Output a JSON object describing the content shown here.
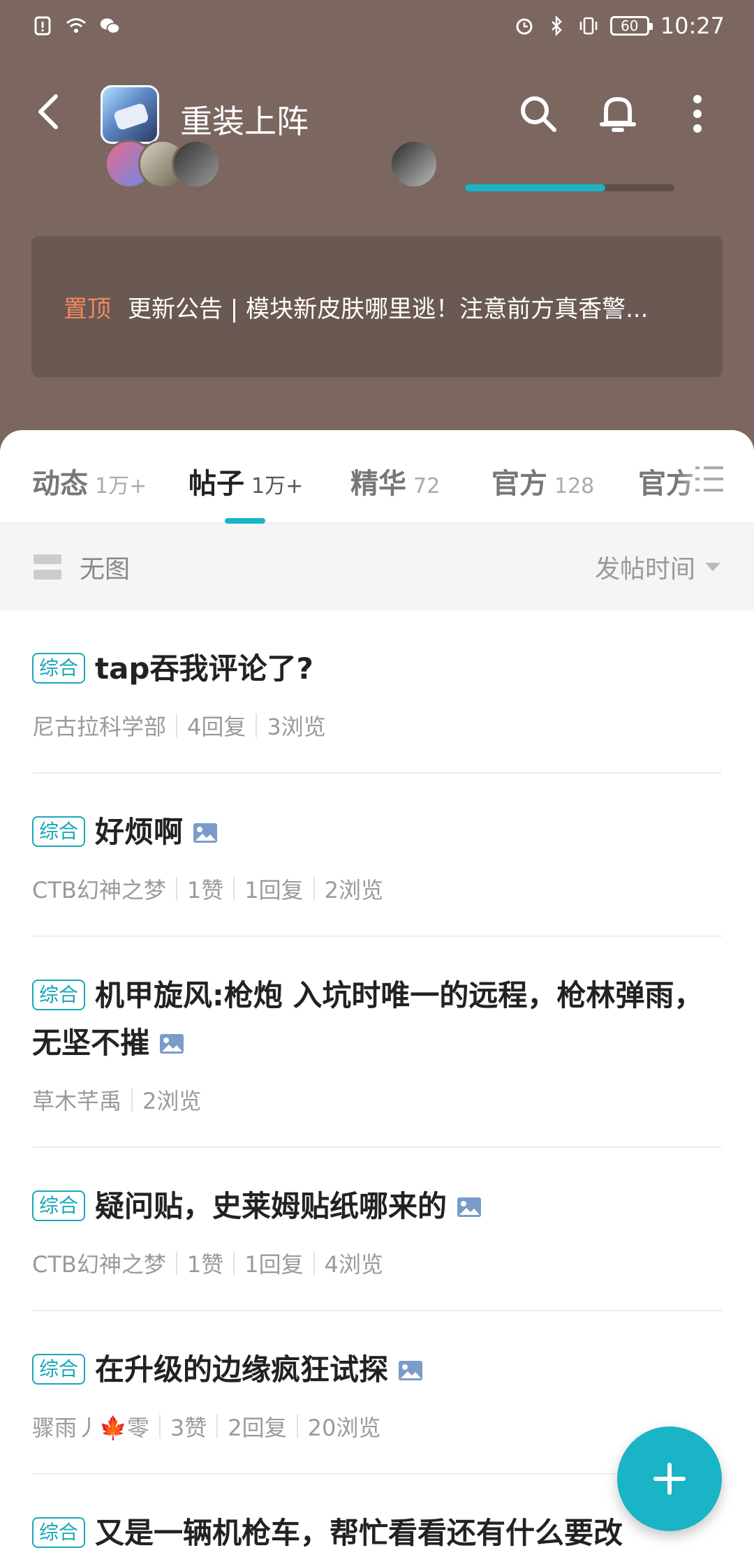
{
  "status_bar": {
    "time": "10:27",
    "battery": "60"
  },
  "header": {
    "title": "重装上阵"
  },
  "notice": {
    "tag": "置顶",
    "text": "更新公告 | 模块新皮肤哪里逃！注意前方真香警..."
  },
  "progress": {
    "fraction": 0.67
  },
  "tabs": [
    {
      "label": "动态",
      "count": "1万+"
    },
    {
      "label": "帖子",
      "count": "1万+"
    },
    {
      "label": "精华",
      "count": "72"
    },
    {
      "label": "官方",
      "count": "128"
    },
    {
      "label": "官方",
      "count": ""
    }
  ],
  "filter": {
    "view_mode": "无图",
    "sort": "发帖时间"
  },
  "posts": [
    {
      "tag": "综合",
      "title": "tap吞我评论了?",
      "has_image": false,
      "meta": [
        "尼古拉科学部",
        "4回复",
        "3浏览"
      ]
    },
    {
      "tag": "综合",
      "title": "好烦啊",
      "has_image": true,
      "meta": [
        "CTB幻神之梦",
        "1赞",
        "1回复",
        "2浏览"
      ]
    },
    {
      "tag": "综合",
      "title": "机甲旋风:枪炮 入坑时唯一的远程，枪林弹雨，无坚不摧",
      "has_image": true,
      "meta": [
        "草木芊禹",
        "2浏览"
      ]
    },
    {
      "tag": "综合",
      "title": "疑问贴，史莱姆贴纸哪来的",
      "has_image": true,
      "meta": [
        "CTB幻神之梦",
        "1赞",
        "1回复",
        "4浏览"
      ]
    },
    {
      "tag": "综合",
      "title": "在升级的边缘疯狂试探",
      "has_image": true,
      "meta": [
        "骤雨丿🍁零",
        "3赞",
        "2回复",
        "20浏览"
      ]
    },
    {
      "tag": "综合",
      "title": "又是一辆机枪车，帮忙看看还有什么要改",
      "has_image": false,
      "meta": []
    }
  ],
  "colors": {
    "header_bg": "#7b6760",
    "accent": "#19b4c6",
    "notice_tag": "#f08a5d"
  },
  "icons": {
    "back": "back-arrow-icon",
    "search": "search-icon",
    "notifications": "bell-icon",
    "more": "more-vertical-icon",
    "add": "plus-icon"
  }
}
